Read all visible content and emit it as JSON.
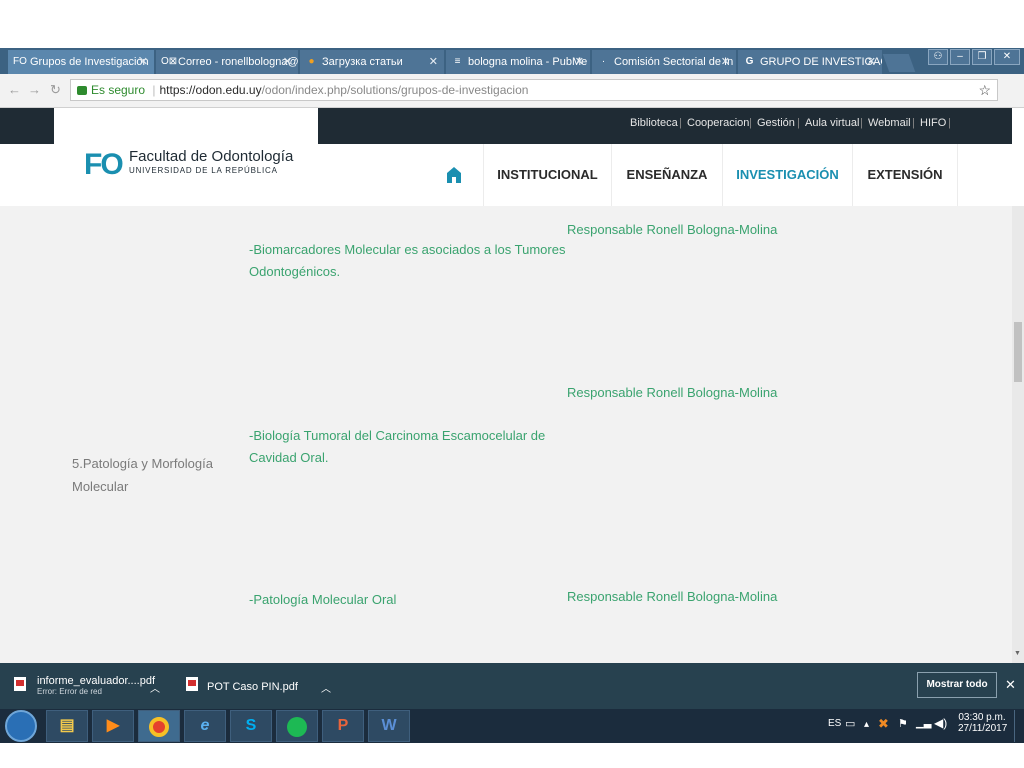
{
  "browser": {
    "tabs": [
      {
        "label": "Grupos de Investigación",
        "icon": "FO",
        "active": true
      },
      {
        "label": "Correo - ronellbologna@",
        "icon": "O⊠"
      },
      {
        "label": "Загрузка статьи",
        "icon": "●"
      },
      {
        "label": "bologna molina - PubMe",
        "icon": "≡"
      },
      {
        "label": "Comisión Sectorial de In",
        "icon": "·"
      },
      {
        "label": "GRUPO DE INVESTIGACI",
        "icon": "G"
      }
    ],
    "secure_label": "Es seguro",
    "url_domain": "https://odon.edu.uy",
    "url_path": "/odon/index.php/solutions/grupos-de-investigacion",
    "star_icon": "star-icon"
  },
  "site": {
    "logo_mark": "FO",
    "logo_title": "Facultad de Odontología",
    "logo_subtitle": "Universidad de la República",
    "top_links": [
      "Biblioteca",
      "Cooperacion",
      "Gestión",
      "Aula virtual",
      "Webmail",
      "HIFO"
    ],
    "nav": [
      "INSTITUCIONAL",
      "ENSEÑANZA",
      "INVESTIGACIÓN",
      "EXTENSIÓN"
    ],
    "accent_color": "#1a8fb0",
    "link_color": "#3aa36f"
  },
  "content": {
    "group_name_line1": "5.Patología y Morfología",
    "group_name_line2": "Molecular",
    "rows": [
      {
        "line1": "-Biomarcadores  Molecular es asociados a los Tumores",
        "line2": "Odontogénicos.",
        "responsible": "Responsable Ronell Bologna-Molina"
      },
      {
        "line1": "-Biología Tumoral del Carcinoma Escamocelular de",
        "line2": "Cavidad Oral.",
        "responsible": "Responsable Ronell Bologna-Molina"
      },
      {
        "line1": "-Patología Molecular Oral",
        "line2": "",
        "responsible": "Responsable Ronell Bologna-Molina"
      }
    ]
  },
  "downloads": {
    "items": [
      {
        "name": "informe_evaluador....pdf",
        "status": "Error: Error de red"
      },
      {
        "name": "POT Caso PIN.pdf",
        "status": ""
      }
    ],
    "show_all": "Mostrar todo"
  },
  "taskbar": {
    "lang": "ES",
    "time": "03:30 p.m.",
    "date": "27/11/2017"
  }
}
